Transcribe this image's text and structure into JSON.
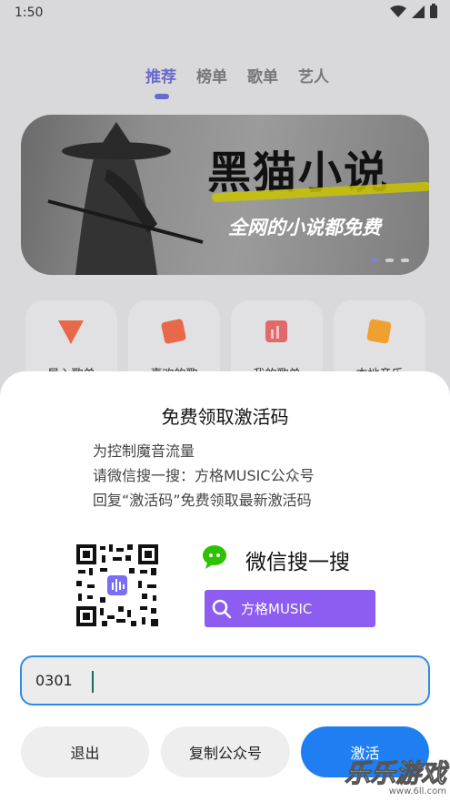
{
  "status_bar": {
    "time": "1:50"
  },
  "tabs": [
    {
      "label": "推荐",
      "active": true
    },
    {
      "label": "榜单",
      "active": false
    },
    {
      "label": "歌单",
      "active": false
    },
    {
      "label": "艺人",
      "active": false
    }
  ],
  "banner": {
    "title": "黑猫小说",
    "subtitle": "全网的小说都免费",
    "page_count": 3,
    "active_page": 1
  },
  "quick_actions": [
    {
      "label": "导入歌单",
      "icon": "import-icon",
      "color": "#e8694a"
    },
    {
      "label": "喜欢的歌",
      "icon": "favorite-icon",
      "color": "#e8694a"
    },
    {
      "label": "我的歌单",
      "icon": "playlist-icon",
      "color": "#e06a6a"
    },
    {
      "label": "本地音乐",
      "icon": "local-music-icon",
      "color": "#f0a030"
    }
  ],
  "dialog": {
    "title": "免费领取激活码",
    "lines": [
      "为控制魔音流量",
      "请微信搜一搜：方格MUSIC公众号",
      "回复“激活码”免费领取最新激活码"
    ],
    "wechat_label": "微信搜一搜",
    "search_text": "方格MUSIC",
    "code_value": "0301",
    "exit_label": "退出",
    "copy_label": "复制公众号",
    "activate_label": "激活"
  },
  "watermark": {
    "title": "乐乐游戏",
    "url": "www.6ll.com"
  },
  "colors": {
    "accent": "#6a6acc",
    "primary_button": "#1f7ff2",
    "search_bg": "#8d5cf0",
    "wechat_green": "#2dc100"
  }
}
